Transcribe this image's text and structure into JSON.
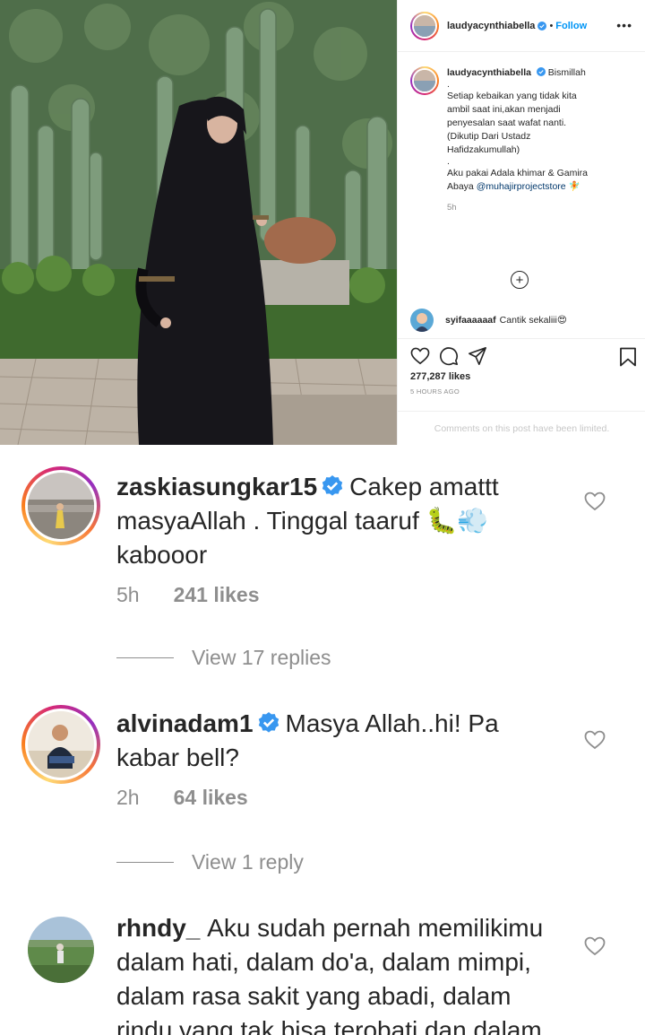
{
  "post": {
    "username": "laudyacynthiabella",
    "separator": "•",
    "follow_label": "Follow",
    "more_label": "•••",
    "caption": {
      "first_line": "Bismillah",
      "lines": [
        ".",
        "Setiap kebaikan yang tidak kita",
        "ambil saat ini,akan menjadi",
        "penyesalan saat wafat nanti.",
        "(Dikutip Dari Ustadz",
        "Hafidzakumullah)",
        ".",
        "Aku pakai Adala khimar & Gamira"
      ],
      "last_line_text": "Abaya ",
      "mention": "@muhajirprojectstore",
      "emoji": "🧚",
      "time": "5h"
    },
    "add_label": "+",
    "top_comment": {
      "username": "syifaaaaaaf",
      "text": "Cantik sekaliii",
      "emoji": "😍"
    },
    "likes": "277,287 likes",
    "timestamp": "5 HOURS AGO",
    "limited_notice": "Comments on this post have been limited."
  },
  "comments": [
    {
      "username": "zaskiasungkar15",
      "verified": true,
      "text_before_emoji": "Cakep amattt masyaAllah . Tinggal taaruf ",
      "emoji": "🐛💨",
      "text_after_emoji": " kabooor",
      "time": "5h",
      "likes": "241 likes",
      "replies": "View 17 replies"
    },
    {
      "username": "alvinadam1",
      "verified": true,
      "text": "Masya Allah..hi!  Pa kabar bell?",
      "time": "2h",
      "likes": "64 likes",
      "replies": "View 1 reply"
    },
    {
      "username": "rhndy_",
      "verified": false,
      "text": "Aku sudah pernah memilikimu dalam hati, dalam do'a, dalam mimpi, dalam rasa sakit yang abadi, dalam rindu yang tak bisa terobati dan dalam"
    }
  ],
  "icons": {
    "verified": "verified-badge-icon",
    "like": "heart-icon",
    "comment": "comment-icon",
    "share": "paper-plane-icon",
    "save": "bookmark-icon"
  },
  "colors": {
    "link": "#0095f6",
    "verified": "#3897f0",
    "muted": "#8e8e8e",
    "text": "#262626"
  }
}
